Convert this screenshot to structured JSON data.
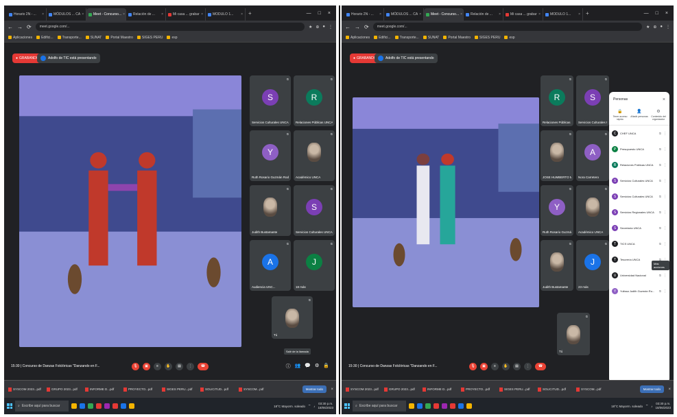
{
  "left": {
    "tabs": [
      {
        "label": "Horario 2N - ...",
        "fav": "blue"
      },
      {
        "label": "MÓDULOS ... CA",
        "fav": "blue"
      },
      {
        "label": "Meet - Concurso...",
        "fav": "grn",
        "active": true
      },
      {
        "label": "Relación de ...",
        "fav": "blue"
      },
      {
        "label": "Mi casa ... grabar",
        "fav": "red"
      },
      {
        "label": "MODULO 1...",
        "fav": "blue"
      }
    ],
    "url": "meet.google.com/...",
    "bookmarks": [
      "Aplicaciones",
      "Edifici...",
      "Transporte...",
      "SUNAT",
      "Portal Maestro",
      "SIGES PERU",
      "esp"
    ],
    "live_label": "GRABANDO",
    "presenting_label": "Adolfo de TIC está presentando",
    "clock": "15:30 | Concurso de Danzas Folclóricas \"Danzando en F...",
    "tiles": [
      {
        "name": "Servicios Culturales UNCA",
        "letter": "S",
        "color": "#7b3fb4"
      },
      {
        "name": "Relaciones Públicas UNCA",
        "letter": "R",
        "color": "#0b7b5c"
      },
      {
        "name": "Ruth Rosario Guzmán Rodríguez",
        "letter": "Y",
        "color": "#8e5fc4"
      },
      {
        "name": "Académico UNCA",
        "letter": "",
        "photo": true
      },
      {
        "name": "Judith Bustamante",
        "letter": "",
        "photo": true
      },
      {
        "name": "Servicios Culturales UNCA",
        "letter": "S",
        "color": "#7b3fb4"
      },
      {
        "name": "Audiencia UNC...",
        "letter": "A",
        "color": "#1a73e8"
      },
      {
        "name": "18 más",
        "letter": "J",
        "color": "#0b8043"
      },
      {
        "name": "Tú",
        "letter": "",
        "photo": true
      }
    ],
    "tooltip": "Salir de la llamada",
    "downloads": [
      "SYSCOM 2023...pdf",
      "GRUPO 2023...pdf",
      "INFORME D...pdf",
      "PROYECTO...pdf",
      "SIGES PERU...pdf",
      "SOLICITUD...pdf",
      "SYSCOM...pdf"
    ],
    "show_all": "Mostrar todo",
    "search_placeholder": "Escribe aquí para buscar",
    "weather": "18°C  Mayorm. soleado",
    "time": "03:30 p.m.",
    "date": "18/06/2023"
  },
  "right": {
    "tabs": [
      {
        "label": "Horario 2N - ...",
        "fav": "blue"
      },
      {
        "label": "MÓDULOS ... CA",
        "fav": "blue"
      },
      {
        "label": "Meet - Concurso...",
        "fav": "grn",
        "active": true
      },
      {
        "label": "Relación de ...",
        "fav": "blue"
      },
      {
        "label": "Mi casa ... grabar",
        "fav": "red"
      },
      {
        "label": "MODULO 1...",
        "fav": "blue"
      }
    ],
    "url": "meet.google.com/...",
    "bookmarks": [
      "Aplicaciones",
      "Edifici...",
      "Transporte...",
      "SUNAT",
      "Portal Maestro",
      "SIGES PERU",
      "esp"
    ],
    "live_label": "GRABANDO",
    "presenting_label": "Adolfo de TIC está presentando",
    "clock": "15:30 | Concurso de Danzas Folclóricas \"Danzando en F...",
    "tiles": [
      {
        "name": "Relaciones Públicas U...",
        "letter": "R",
        "color": "#0b7b5c"
      },
      {
        "name": "Servicios Culturales UN...",
        "letter": "S",
        "color": "#7b3fb4"
      },
      {
        "name": "JOSE HUMBERTO MUNAY...",
        "letter": "",
        "photo": true
      },
      {
        "name": "Nora Carretero",
        "letter": "A",
        "color": "#8e5fc4"
      },
      {
        "name": "Ruth Rosario Guzmán Ro...",
        "letter": "Y",
        "color": "#8e5fc4"
      },
      {
        "name": "Académico UNCA",
        "letter": "",
        "photo": true
      },
      {
        "name": "Judith Bustamante",
        "letter": "",
        "photo": true
      },
      {
        "name": "23 más",
        "letter": "J",
        "color": "#1a73e8"
      },
      {
        "name": "Tú",
        "letter": "",
        "photo": true
      }
    ],
    "downloads": [
      "SYSCOM 2023...pdf",
      "GRUPO 2023...pdf",
      "INFORME D...pdf",
      "PROYECTO...pdf",
      "SIGES PERU...pdf",
      "SOLICITUD...pdf",
      "SYSCOM...pdf"
    ],
    "show_all": "Mostrar todo",
    "search_placeholder": "Escribe aquí para buscar",
    "weather": "18°C  Mayorm. soleado",
    "time": "03:30 p.m.",
    "date": "18/06/2023",
    "panel": {
      "title": "Personas",
      "options": [
        "Tener acceso rápido",
        "Añadir personas",
        "Contenido del organizador"
      ],
      "people": [
        {
          "name": "CHEF UNCA",
          "color": "#202124"
        },
        {
          "name": "Presupuesto UNCA",
          "color": "#0b8043"
        },
        {
          "name": "Relaciones Públicas UNCA",
          "color": "#0b7b5c"
        },
        {
          "name": "Servicios Culturales UNCA",
          "color": "#7b3fb4"
        },
        {
          "name": "Servicios Culturales UNCA",
          "color": "#7b3fb4"
        },
        {
          "name": "Servicios Regionales UNCA",
          "color": "#7b3fb4"
        },
        {
          "name": "Secretaría UNCA",
          "color": "#7b3fb4"
        },
        {
          "name": "TICS UNCA",
          "color": "#202124"
        },
        {
          "name": "Tesorería UNCA",
          "color": "#202124"
        },
        {
          "name": "Universidad Nacional",
          "color": "#202124"
        },
        {
          "name": "Yulissa Judith Guzmán Ru...",
          "color": "#8e5fc4"
        }
      ],
      "tooltip": "Más acciones"
    }
  }
}
